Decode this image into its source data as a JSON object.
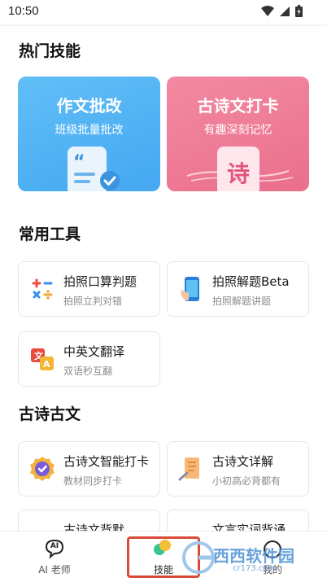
{
  "status_bar": {
    "time": "10:50"
  },
  "sections": {
    "hot_skills": "热门技能",
    "common_tools": "常用工具",
    "ancient_poetry": "古诗古文"
  },
  "feature_cards": [
    {
      "title": "作文批改",
      "subtitle": "班级批量批改",
      "color": "#4aaef3"
    },
    {
      "title": "古诗文打卡",
      "subtitle": "有趣深刻记忆",
      "badge": "诗",
      "color": "#ee7893"
    }
  ],
  "tools": [
    {
      "title": "拍照口算判题",
      "subtitle": "拍照立判对错",
      "icon": "math-symbols-icon"
    },
    {
      "title": "拍照解题Beta",
      "subtitle": "拍照解题讲题",
      "icon": "phone-camera-icon"
    },
    {
      "title": "中英文翻译",
      "subtitle": "双语秒互翻",
      "icon": "translate-icon"
    }
  ],
  "poetry_tools": [
    {
      "title": "古诗文智能打卡",
      "subtitle": "教材同步打卡",
      "icon": "badge-icon"
    },
    {
      "title": "古诗文详解",
      "subtitle": "小初高必背都有",
      "icon": "scroll-icon"
    },
    {
      "title": "古诗文背默",
      "subtitle": "",
      "icon": "book-icon"
    },
    {
      "title": "文言实词背诵",
      "subtitle": "",
      "icon": "notebook-icon"
    }
  ],
  "nav": {
    "ai_teacher": "AI 老师",
    "ai_badge": "AI",
    "skills": "技能",
    "me": "我的"
  },
  "watermark": {
    "text": "西西软件园",
    "url_text": "cr173.com"
  }
}
